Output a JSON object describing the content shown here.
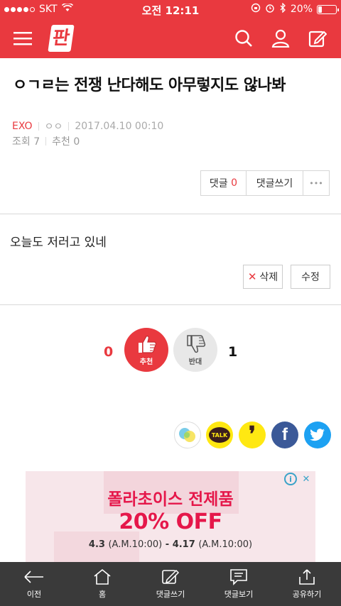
{
  "status_bar": {
    "carrier": "SKT",
    "time": "오전 12:11",
    "battery": "20%",
    "battery_level": 0.2
  },
  "header": {
    "logo": "판",
    "icons": [
      "menu-icon",
      "search-icon",
      "user-icon",
      "edit-icon"
    ]
  },
  "post": {
    "title": "ㅇㄱㄹ는 전쟁 난다해도 아무렇지도 않나봐",
    "category": "EXO",
    "author": "ㅇㅇ",
    "date": "2017.04.10 00:10",
    "views": "조회 7",
    "recommends": "추천 0",
    "body": "오늘도 저러고 있네"
  },
  "actions": {
    "comment_label": "댓글",
    "comment_count": "0",
    "write_comment": "댓글쓰기",
    "more": "•••",
    "delete": "삭제",
    "edit": "수정"
  },
  "vote": {
    "up_count": "0",
    "up_label": "추천",
    "down_count": "1",
    "down_label": "반대"
  },
  "share": {
    "kakao_talk": "TALK",
    "kakao_story": "❜"
  },
  "ad": {
    "headline": "폴라초이스 전제품",
    "promo": "20% OFF",
    "date_start": "4.3",
    "start_time": "(A.M.10:00)",
    "dash": "-",
    "date_end": "4.17",
    "end_time": "(A.M.10:00)",
    "info_icon": "i",
    "close_icon": "✕"
  },
  "toolbar": {
    "items": [
      {
        "label": "이전",
        "icon": "back-arrow-icon"
      },
      {
        "label": "홈",
        "icon": "home-icon"
      },
      {
        "label": "댓글쓰기",
        "icon": "write-comment-icon"
      },
      {
        "label": "댓글보기",
        "icon": "view-comments-icon"
      },
      {
        "label": "공유하기",
        "icon": "share-icon"
      }
    ]
  },
  "colors": {
    "brand": "#e9393f",
    "toolbar": "#3a3a3a",
    "facebook": "#3b5998",
    "twitter": "#1da1f2",
    "kakao": "#ffe812"
  }
}
